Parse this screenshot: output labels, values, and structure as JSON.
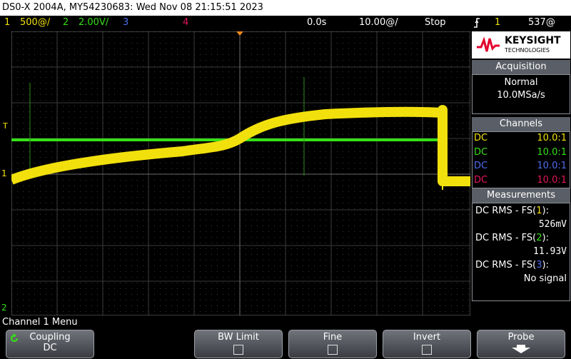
{
  "title": "DS0-X 2004A, MY54230683: Wed Nov 08 21:15:51 2023",
  "status": {
    "ch1_num": "1",
    "ch1_scale": "500@/",
    "ch2_num": "2",
    "ch2_scale": "2.00V/",
    "ch3_num": "3",
    "ch4_num": "4",
    "delay": "0.0s",
    "timebase": "10.00@/",
    "run_state": "Stop",
    "trig_source": "1",
    "trig_level": "537@"
  },
  "brand": {
    "name": "KEYSIGHT",
    "sub": "TECHNOLOGIES"
  },
  "acquisition": {
    "header": "Acquisition",
    "mode": "Normal",
    "rate": "10.0MSa/s"
  },
  "channels": {
    "header": "Channels",
    "rows": [
      {
        "coupling": "DC",
        "probe": "10.0:1",
        "color": "#f2e00c"
      },
      {
        "coupling": "DC",
        "probe": "10.0:1",
        "color": "#36e018"
      },
      {
        "coupling": "DC",
        "probe": "10.0:1",
        "color": "#4f6cf0"
      },
      {
        "coupling": "DC",
        "probe": "10.0:1",
        "color": "#e8155e"
      }
    ]
  },
  "measurements": {
    "header": "Measurements",
    "items": [
      {
        "pre": "DC RMS - FS(",
        "ch": "1",
        "post": "):",
        "value": "526mV",
        "color": "#f2e00c"
      },
      {
        "pre": "DC RMS - FS(",
        "ch": "2",
        "post": "):",
        "value": "11.93V",
        "color": "#36e018"
      },
      {
        "pre": "DC RMS - FS(",
        "ch": "3",
        "post": "):",
        "value": "No signal",
        "color": "#4f6cf0"
      }
    ]
  },
  "markers": {
    "trig": "T",
    "ch1": "1",
    "ch2": "2"
  },
  "menu": {
    "title": "Channel 1 Menu",
    "coupling_label": "Coupling",
    "coupling_value": "DC",
    "bwlimit_label": "BW Limit",
    "fine_label": "Fine",
    "invert_label": "Invert",
    "probe_label": "Probe"
  },
  "colors": {
    "ch1": "#f2e00c",
    "ch2": "#36e018",
    "ch3": "#4f6cf0",
    "ch4": "#e8155e",
    "grid": "#3a3a3a",
    "trigger_marker": "#f08a1c"
  }
}
